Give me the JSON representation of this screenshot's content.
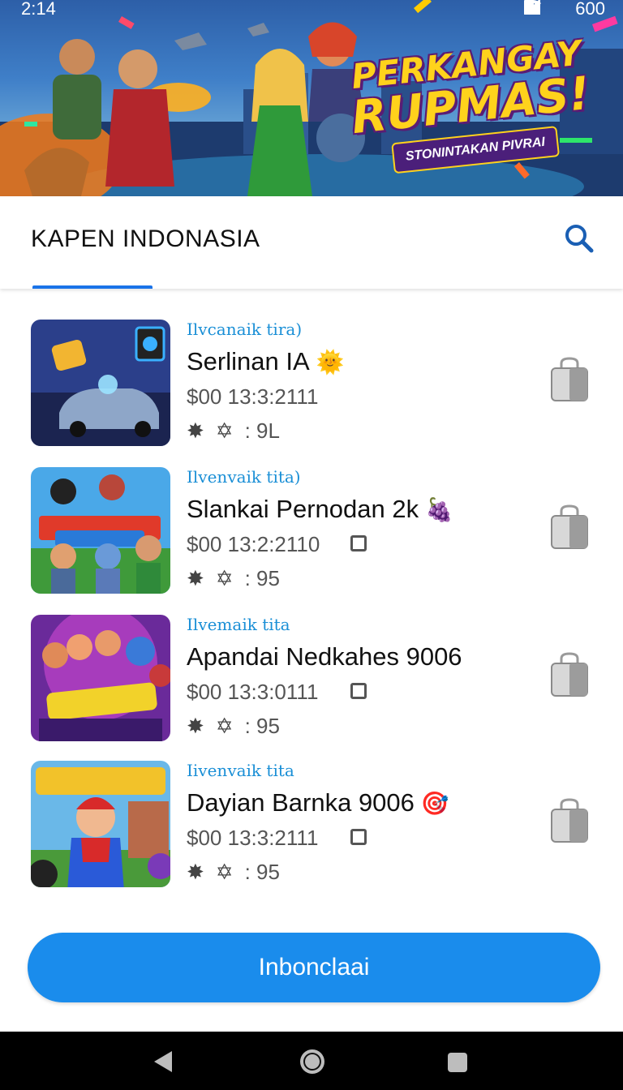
{
  "status_bar": {
    "time": "2:14",
    "battery": "600",
    "icons": [
      "heart-icon",
      "wifi-icon",
      "signal-icon",
      "signal-icon",
      "battery-icon"
    ]
  },
  "hero": {
    "title_line1": "PERKANGAY",
    "title_line2": "RUPMAS!",
    "subtitle": "STONINTAKAN PIVRAI"
  },
  "header": {
    "title": "KAPEN INDONASIA",
    "search_icon": "search-icon"
  },
  "items": [
    {
      "category": "Ilvcanaik tira)",
      "title": "Serlinan IA",
      "emoji": "🌞",
      "price": "$00 13:3:2111",
      "stat": ": 9L",
      "show_checkbox": false
    },
    {
      "category": "Ilvenvaik tita)",
      "title": "Slankai Pernodan 2k",
      "emoji": "🍇",
      "price": "$00 13:2:2110",
      "stat": ": 95",
      "show_checkbox": true
    },
    {
      "category": "Ilvemaik tita",
      "title": "Apandai Nedkahes 9006",
      "emoji": "",
      "price": "$00 13:3:0111",
      "stat": ": 95",
      "show_checkbox": true
    },
    {
      "category": "Iivenvaik tita",
      "title": "Dayian Barnka 9006",
      "emoji": "🎯",
      "price": "$00 13:3:2111",
      "stat": ": 95",
      "show_checkbox": true
    }
  ],
  "primary_button": {
    "label": "Inbonclaai"
  },
  "colors": {
    "accent": "#1a8cec",
    "category_text": "#1a8fd6",
    "tab_indicator": "#1a73e8"
  }
}
